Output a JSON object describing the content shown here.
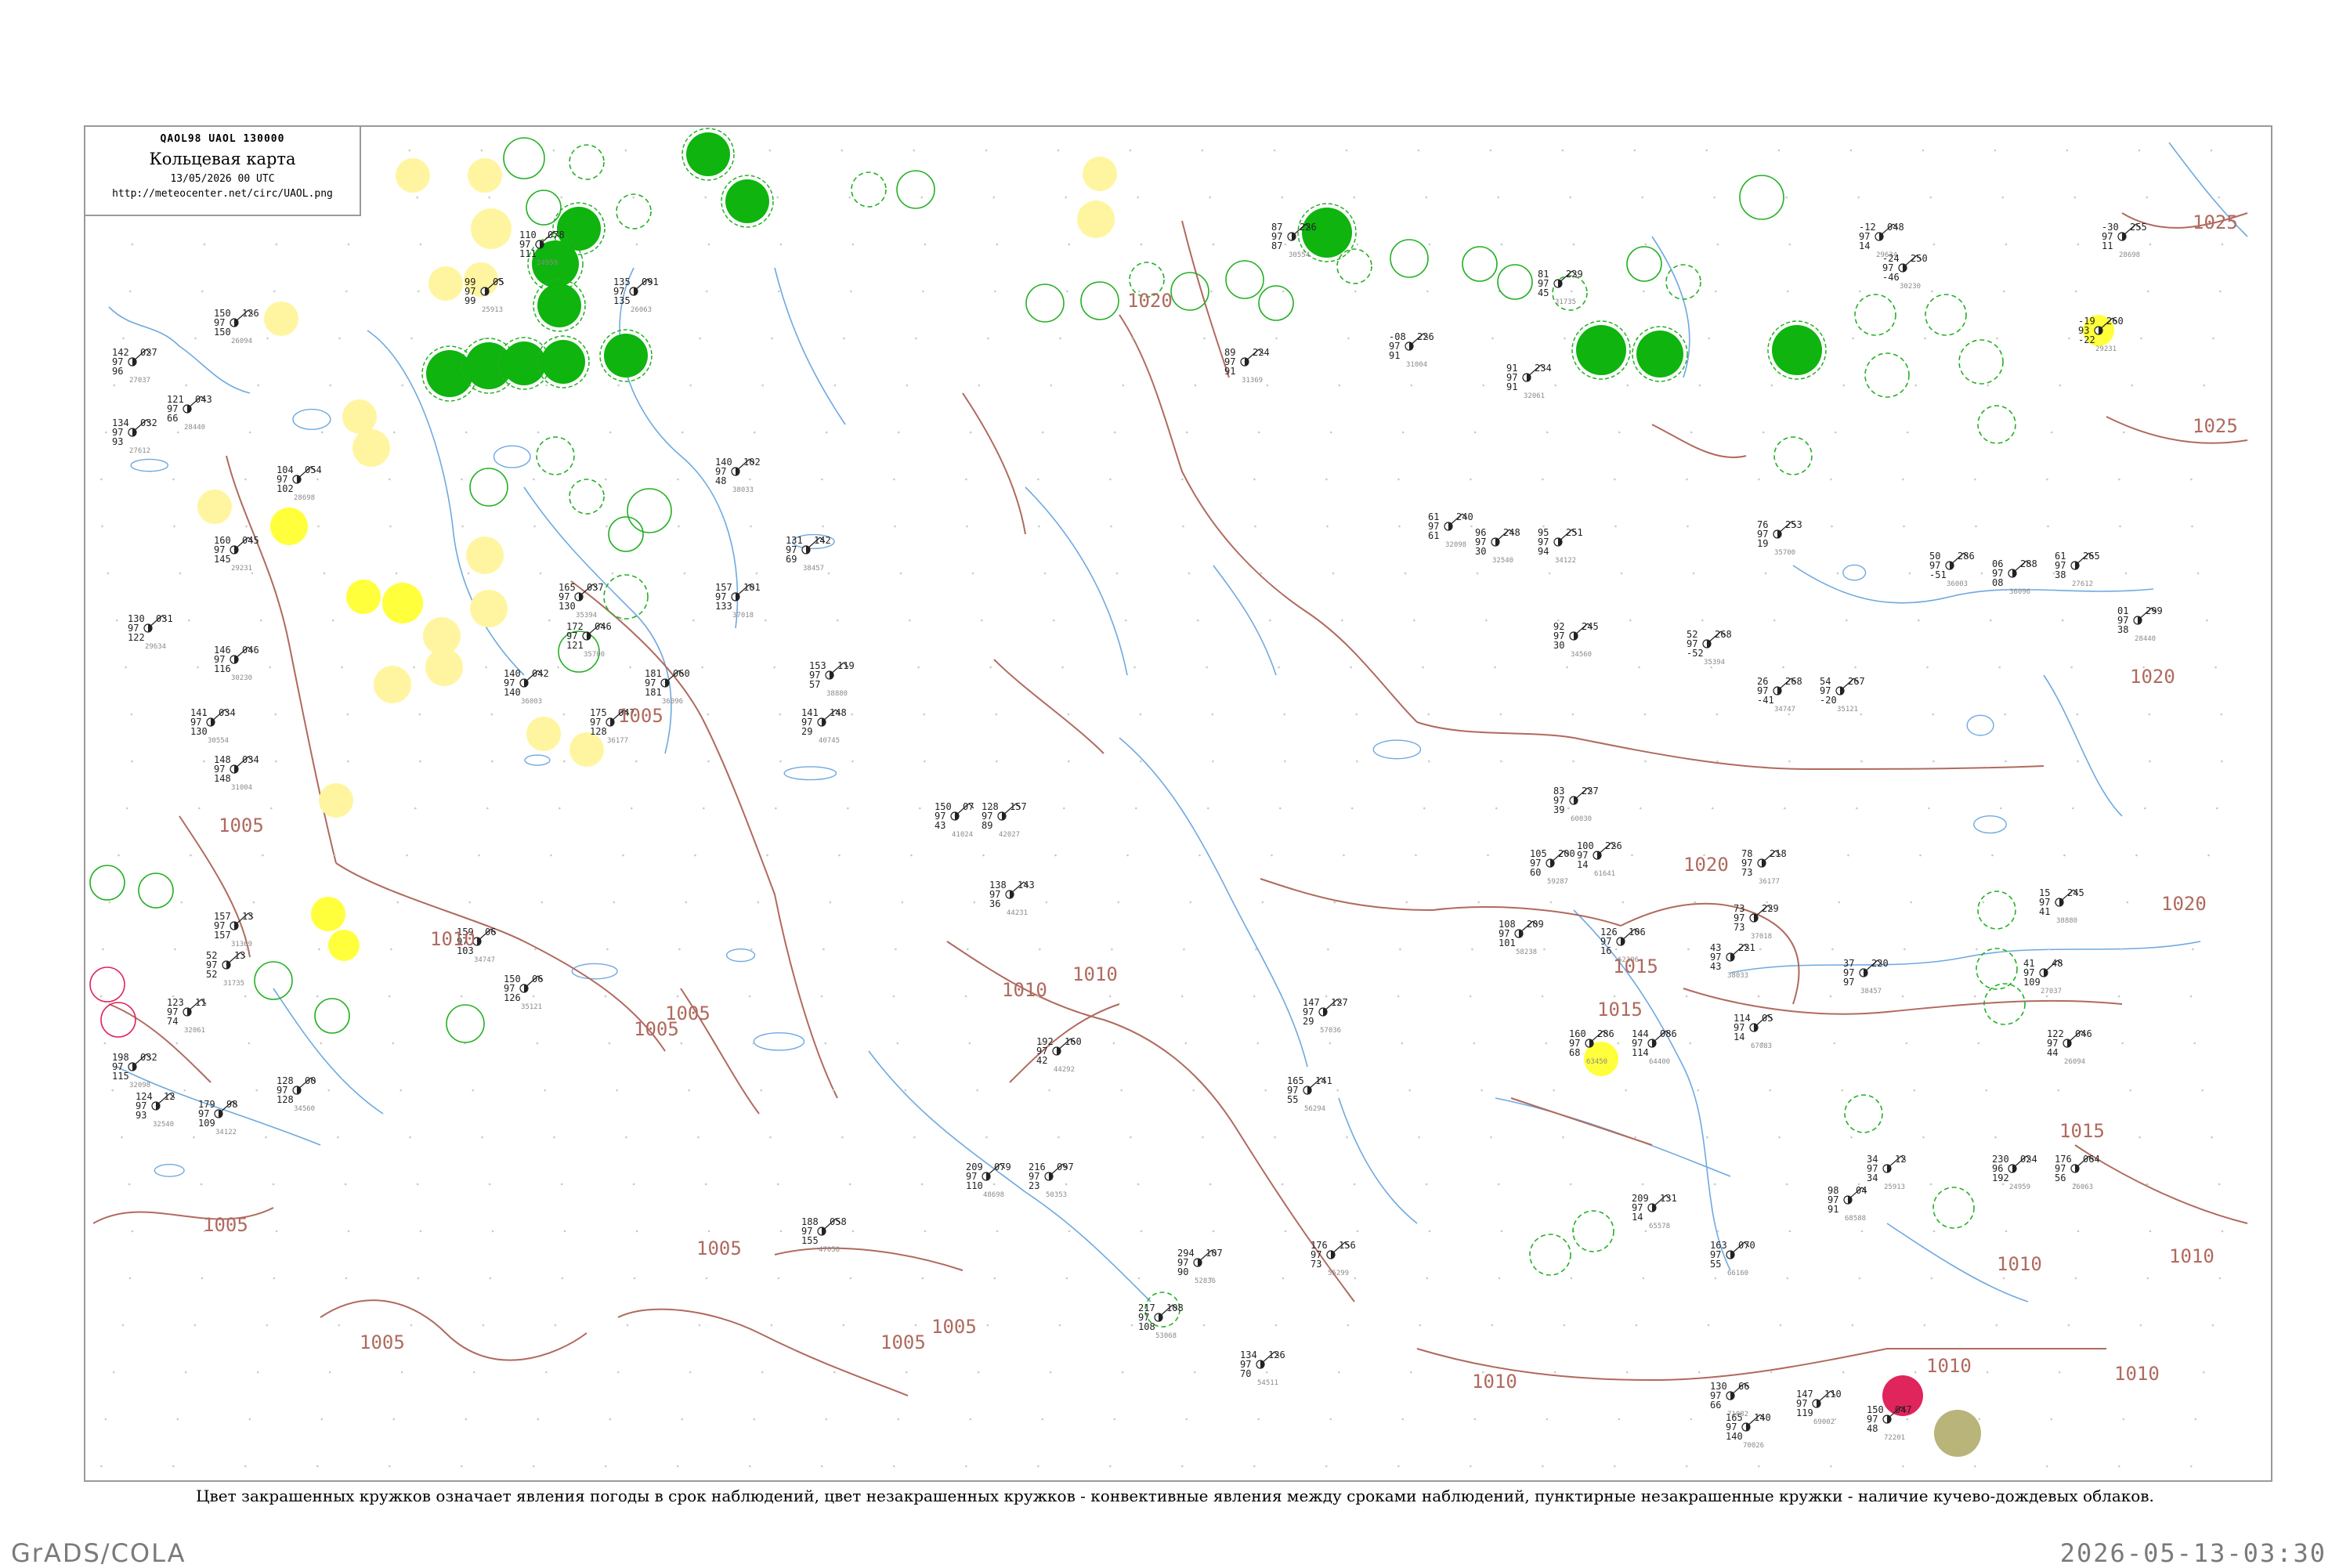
{
  "header": {
    "codes": "QAOL98  UAOL  130000",
    "title": "Кольцевая карта",
    "date": "13/05/2026 00 UTC",
    "url": "http://meteocenter.net/circ/UAOL.png"
  },
  "footnote": "Цвет закрашенных кружков означает явления погоды в срок наблюдений, цвет незакрашенных кружков - конвективные явления между сроками наблюдений, пунктирные незакрашенные кружки - наличие кучево-дождевых облаков.",
  "credit": "GrADS/COLA",
  "timestamp": "2026-05-13-03:30",
  "colors": {
    "isobar": "#b06a5e",
    "river": "#6ea9e0",
    "precip_fill": "#0fb40f",
    "haze_fill": "#ffff3c",
    "pale_yellow": "#fff5a0",
    "convective_ring": "#23b023",
    "thunder_red": "#e0245c",
    "dust_olive": "#b8b47a"
  },
  "isobar_labels": [
    "1005",
    "1005",
    "1010",
    "1005",
    "1005",
    "1005",
    "1005",
    "1010",
    "1005",
    "1005",
    "1005",
    "1010",
    "1020",
    "1010",
    "1015",
    "1015",
    "1020",
    "1020",
    "1025",
    "1025",
    "1015",
    "1010",
    "1010",
    "1010",
    "1010",
    "1020"
  ],
  "stations": [
    {
      "top": "110",
      "mid": "97",
      "right": "078",
      "bot": "111"
    },
    {
      "top": "99",
      "mid": "97",
      "right": "05",
      "bot": "99"
    },
    {
      "top": "135",
      "mid": "97",
      "right": "091",
      "bot": "135"
    },
    {
      "top": "150",
      "mid": "97",
      "right": "126",
      "bot": "150"
    },
    {
      "top": "142",
      "mid": "97",
      "right": "027",
      "bot": "96"
    },
    {
      "top": "134",
      "mid": "97",
      "right": "032",
      "bot": "93"
    },
    {
      "top": "121",
      "mid": "97",
      "right": "043",
      "bot": "66"
    },
    {
      "top": "104",
      "mid": "97",
      "right": "054",
      "bot": "102"
    },
    {
      "top": "160",
      "mid": "97",
      "right": "045",
      "bot": "145"
    },
    {
      "top": "130",
      "mid": "97",
      "right": "031",
      "bot": "122"
    },
    {
      "top": "146",
      "mid": "97",
      "right": "046",
      "bot": "116"
    },
    {
      "top": "141",
      "mid": "97",
      "right": "034",
      "bot": "130"
    },
    {
      "top": "148",
      "mid": "97",
      "right": "034",
      "bot": "148"
    },
    {
      "top": "157",
      "mid": "97",
      "right": "13",
      "bot": "157"
    },
    {
      "top": "52",
      "mid": "97",
      "right": "13",
      "bot": "52"
    },
    {
      "top": "123",
      "mid": "97",
      "right": "11",
      "bot": "74"
    },
    {
      "top": "198",
      "mid": "97",
      "right": "032",
      "bot": "115"
    },
    {
      "top": "124",
      "mid": "97",
      "right": "12",
      "bot": "93"
    },
    {
      "top": "179",
      "mid": "97",
      "right": "98",
      "bot": "109"
    },
    {
      "top": "128",
      "mid": "97",
      "right": "00",
      "bot": "128"
    },
    {
      "top": "159",
      "mid": "97",
      "right": "06",
      "bot": "103"
    },
    {
      "top": "150",
      "mid": "97",
      "right": "06",
      "bot": "126"
    },
    {
      "top": "165",
      "mid": "97",
      "right": "037",
      "bot": "130"
    },
    {
      "top": "172",
      "mid": "97",
      "right": "046",
      "bot": "121"
    },
    {
      "top": "140",
      "mid": "97",
      "right": "042",
      "bot": "140"
    },
    {
      "top": "181",
      "mid": "97",
      "right": "060",
      "bot": "181"
    },
    {
      "top": "175",
      "mid": "97",
      "right": "047",
      "bot": "128"
    },
    {
      "top": "157",
      "mid": "97",
      "right": "101",
      "bot": "133"
    },
    {
      "top": "140",
      "mid": "97",
      "right": "102",
      "bot": "48"
    },
    {
      "top": "131",
      "mid": "97",
      "right": "142",
      "bot": "69"
    },
    {
      "top": "153",
      "mid": "97",
      "right": "119",
      "bot": "57"
    },
    {
      "top": "141",
      "mid": "97",
      "right": "148",
      "bot": "29"
    },
    {
      "top": "150",
      "mid": "97",
      "right": "07",
      "bot": "43"
    },
    {
      "top": "128",
      "mid": "97",
      "right": "157",
      "bot": "89"
    },
    {
      "top": "138",
      "mid": "97",
      "right": "143",
      "bot": "36"
    },
    {
      "top": "192",
      "mid": "97",
      "right": "160",
      "bot": "42"
    },
    {
      "top": "188",
      "mid": "97",
      "right": "058",
      "bot": "155"
    },
    {
      "top": "209",
      "mid": "97",
      "right": "079",
      "bot": "110"
    },
    {
      "top": "216",
      "mid": "97",
      "right": "097",
      "bot": "23"
    },
    {
      "top": "294",
      "mid": "97",
      "right": "107",
      "bot": "90"
    },
    {
      "top": "217",
      "mid": "97",
      "right": "108",
      "bot": "108"
    },
    {
      "top": "134",
      "mid": "97",
      "right": "126",
      "bot": "70"
    },
    {
      "top": "176",
      "mid": "97",
      "right": "156",
      "bot": "73"
    },
    {
      "top": "165",
      "mid": "97",
      "right": "141",
      "bot": "55"
    },
    {
      "top": "147",
      "mid": "97",
      "right": "127",
      "bot": "29"
    },
    {
      "top": "108",
      "mid": "97",
      "right": "209",
      "bot": "101"
    },
    {
      "top": "105",
      "mid": "97",
      "right": "200",
      "bot": "60"
    },
    {
      "top": "83",
      "mid": "97",
      "right": "227",
      "bot": "39"
    },
    {
      "top": "100",
      "mid": "97",
      "right": "226",
      "bot": "14"
    },
    {
      "top": "126",
      "mid": "97",
      "right": "106",
      "bot": "16"
    },
    {
      "top": "160",
      "mid": "97",
      "right": "286",
      "bot": "68"
    },
    {
      "top": "144",
      "mid": "97",
      "right": "086",
      "bot": "114"
    },
    {
      "top": "209",
      "mid": "97",
      "right": "131",
      "bot": "14"
    },
    {
      "top": "163",
      "mid": "97",
      "right": "070",
      "bot": "55"
    },
    {
      "top": "114",
      "mid": "97",
      "right": "05",
      "bot": "14"
    },
    {
      "top": "98",
      "mid": "97",
      "right": "04",
      "bot": "91"
    },
    {
      "top": "147",
      "mid": "97",
      "right": "110",
      "bot": "119"
    },
    {
      "top": "165",
      "mid": "97",
      "right": "140",
      "bot": "140"
    },
    {
      "top": "130",
      "mid": "97",
      "right": "66",
      "bot": "66"
    },
    {
      "top": "150",
      "mid": "97",
      "right": "047",
      "bot": "48"
    },
    {
      "top": "230",
      "mid": "96",
      "right": "024",
      "bot": "192"
    },
    {
      "top": "34",
      "mid": "97",
      "right": "12",
      "bot": "34"
    },
    {
      "top": "176",
      "mid": "97",
      "right": "064",
      "bot": "56"
    },
    {
      "top": "122",
      "mid": "97",
      "right": "046",
      "bot": "44"
    },
    {
      "top": "41",
      "mid": "97",
      "right": "48",
      "bot": "109"
    },
    {
      "top": "61",
      "mid": "97",
      "right": "265",
      "bot": "38"
    },
    {
      "top": "01",
      "mid": "97",
      "right": "299",
      "bot": "38"
    },
    {
      "top": "-30",
      "mid": "97",
      "right": "255",
      "bot": "11"
    },
    {
      "top": "-19",
      "mid": "93",
      "right": "260",
      "bot": "-22"
    },
    {
      "top": "-12",
      "mid": "97",
      "right": "048",
      "bot": "14"
    },
    {
      "top": "-24",
      "mid": "97",
      "right": "250",
      "bot": "-46"
    },
    {
      "top": "87",
      "mid": "97",
      "right": "226",
      "bot": "87"
    },
    {
      "top": "-08",
      "mid": "97",
      "right": "226",
      "bot": "91"
    },
    {
      "top": "89",
      "mid": "97",
      "right": "224",
      "bot": "91"
    },
    {
      "top": "81",
      "mid": "97",
      "right": "229",
      "bot": "45"
    },
    {
      "top": "91",
      "mid": "97",
      "right": "234",
      "bot": "91"
    },
    {
      "top": "61",
      "mid": "97",
      "right": "240",
      "bot": "61"
    },
    {
      "top": "96",
      "mid": "97",
      "right": "248",
      "bot": "30"
    },
    {
      "top": "95",
      "mid": "97",
      "right": "251",
      "bot": "94"
    },
    {
      "top": "92",
      "mid": "97",
      "right": "245",
      "bot": "30"
    },
    {
      "top": "26",
      "mid": "97",
      "right": "268",
      "bot": "-41"
    },
    {
      "top": "54",
      "mid": "97",
      "right": "267",
      "bot": "-20"
    },
    {
      "top": "52",
      "mid": "97",
      "right": "268",
      "bot": "-52"
    },
    {
      "top": "76",
      "mid": "97",
      "right": "253",
      "bot": "19"
    },
    {
      "top": "50",
      "mid": "97",
      "right": "286",
      "bot": "-51"
    },
    {
      "top": "06",
      "mid": "97",
      "right": "288",
      "bot": "08"
    },
    {
      "top": "78",
      "mid": "97",
      "right": "218",
      "bot": "73"
    },
    {
      "top": "73",
      "mid": "97",
      "right": "229",
      "bot": "73"
    },
    {
      "top": "43",
      "mid": "97",
      "right": "221",
      "bot": "43"
    },
    {
      "top": "37",
      "mid": "97",
      "right": "220",
      "bot": "97"
    },
    {
      "top": "15",
      "mid": "97",
      "right": "245",
      "bot": "41"
    }
  ],
  "station_ids": [
    "24959",
    "25913",
    "26063",
    "26094",
    "27037",
    "27612",
    "28440",
    "28698",
    "29231",
    "29634",
    "30230",
    "30554",
    "31004",
    "31369",
    "31735",
    "32061",
    "32098",
    "32540",
    "34122",
    "34560",
    "34747",
    "35121",
    "35394",
    "35700",
    "36003",
    "36096",
    "36177",
    "37018",
    "38033",
    "38457",
    "38880",
    "40745",
    "41024",
    "42027",
    "44231",
    "44292",
    "47058",
    "48698",
    "50353",
    "52836",
    "53068",
    "54511",
    "55299",
    "56294",
    "57036",
    "58238",
    "59287",
    "60030",
    "61641",
    "62306",
    "63450",
    "64400",
    "65578",
    "66160",
    "67083",
    "68588",
    "69002",
    "70026",
    "71082",
    "72201"
  ]
}
